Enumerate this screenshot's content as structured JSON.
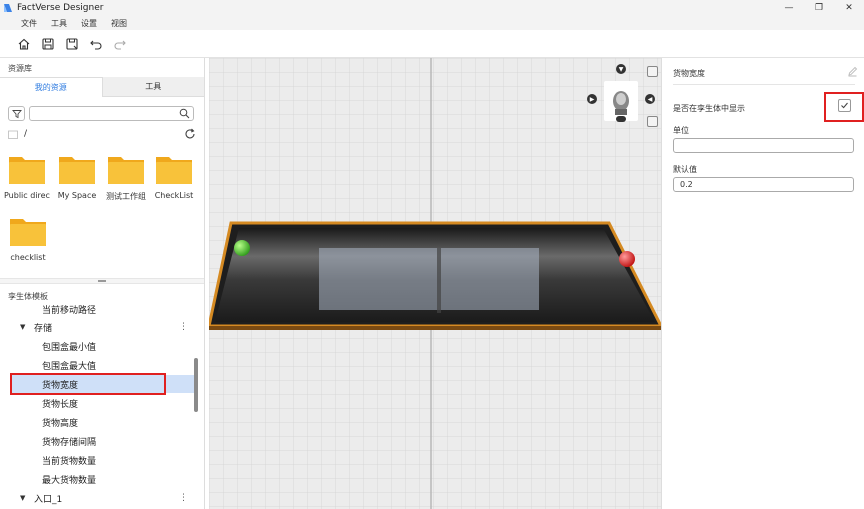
{
  "window": {
    "title": "FactVerse Designer",
    "controls": [
      "—",
      "❐",
      "✕"
    ]
  },
  "menu": [
    "文件",
    "工具",
    "设置",
    "视图"
  ],
  "toolbar": [
    "home-icon",
    "save-icon",
    "save-as-icon",
    "undo-icon",
    "redo-icon"
  ],
  "resources": {
    "header": "资源库",
    "tabs": {
      "mine": "我的资源",
      "tools": "工具"
    },
    "search": {
      "value": "",
      "placeholder": ""
    },
    "path": "/",
    "folders": [
      {
        "label": "Public direc…"
      },
      {
        "label": "My Space"
      },
      {
        "label": "测试工作组"
      },
      {
        "label": "CheckList"
      },
      {
        "label": "checklist"
      }
    ]
  },
  "twin_template": {
    "header": "孪生体模板",
    "items": [
      {
        "label": "当前移动路径",
        "level": 2
      },
      {
        "label": "存储",
        "level": 1,
        "expanded": true,
        "menu": "⋮"
      },
      {
        "label": "包围盒最小值",
        "level": 2
      },
      {
        "label": "包围盒最大值",
        "level": 2
      },
      {
        "label": "货物宽度",
        "level": 2,
        "selected": true
      },
      {
        "label": "货物长度",
        "level": 2
      },
      {
        "label": "货物高度",
        "level": 2
      },
      {
        "label": "货物存储间隔",
        "level": 2
      },
      {
        "label": "当前货物数量",
        "level": 2
      },
      {
        "label": "最大货物数量",
        "level": 2
      },
      {
        "label": "入口_1",
        "level": 1,
        "expanded": true,
        "menu": "⋮"
      }
    ]
  },
  "properties": {
    "title": "货物宽度",
    "show_in_twin_label": "是否在孪生体中显示",
    "show_in_twin_checked": true,
    "unit_label": "单位",
    "unit_value": "",
    "default_label": "默认值",
    "default_value": "0.2"
  },
  "colors": {
    "accent": "#2e7be0",
    "folder": "#f6b928",
    "highlight_box": "#e02020",
    "selection": "#cfe0f8"
  }
}
